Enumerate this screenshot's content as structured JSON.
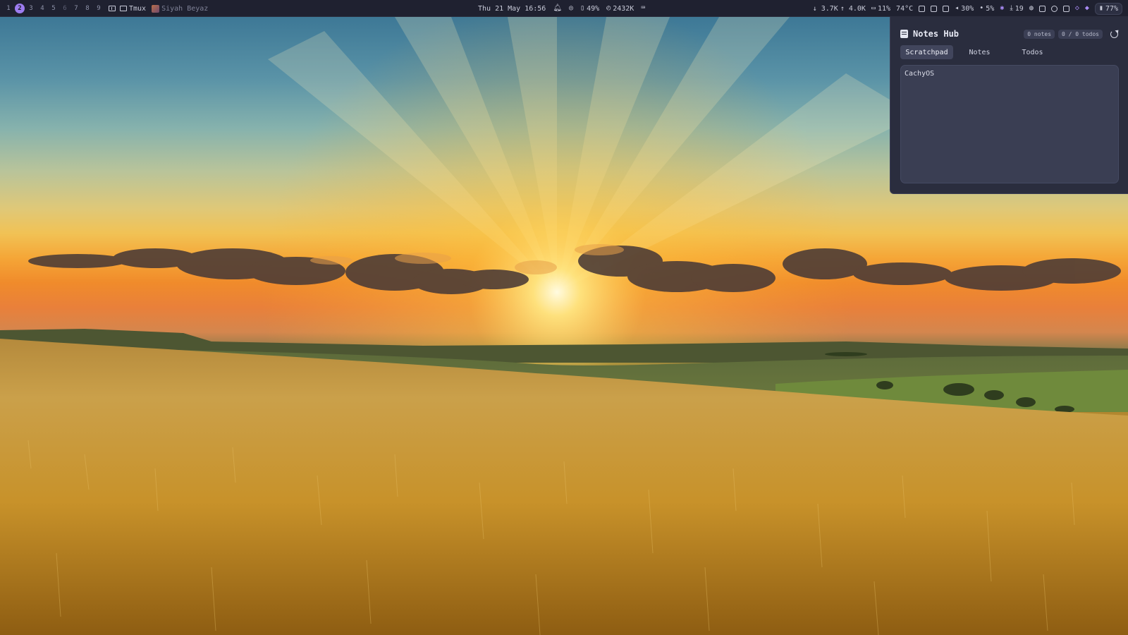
{
  "topbar": {
    "workspaces": [
      "1",
      "2",
      "3",
      "4",
      "5",
      "6",
      "7",
      "8",
      "9"
    ],
    "active_workspace": "2",
    "active_window": "Tmux",
    "app_title": "Siyah Beyaz",
    "clock": "Thu 21 May 16:56",
    "phone_battery": "49%",
    "memory": "2432K",
    "net_down": "↓ 3.7K",
    "net_up": "↑ 4.0K",
    "cpu": "11%",
    "temperature": "74°C",
    "volume": "30%",
    "mic": "5%",
    "updates": "19",
    "battery": "77%"
  },
  "notes_hub": {
    "title": "Notes Hub",
    "notes_count": "0 notes",
    "todos_count": "0 / 0 todos",
    "tabs": [
      "Scratchpad",
      "Notes",
      "Todos"
    ],
    "active_tab": "Scratchpad",
    "scratchpad_text": "CachyOS"
  },
  "colors": {
    "bar_bg": "#1f2130",
    "accent": "#9d7cf0",
    "panel_bg": "#2a2d3e",
    "textarea_bg": "#3a3e53"
  },
  "icons": [
    "window-icon",
    "layout-icon",
    "bell-icon",
    "eye-off-icon",
    "phone-icon",
    "memory-icon",
    "keyboard-icon",
    "laptop-icon",
    "monitor-icon",
    "clipboard-icon",
    "volume-icon",
    "mic-icon",
    "bluetooth-icon",
    "download-icon",
    "globe-icon",
    "notes-icon",
    "circle-icon",
    "terminal-icon",
    "shield-icon",
    "vpn-icon",
    "battery-icon",
    "refresh-icon"
  ]
}
